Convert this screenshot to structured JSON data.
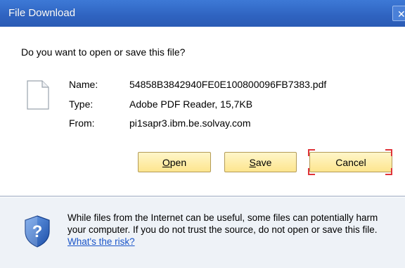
{
  "window": {
    "title": "File Download",
    "close_glyph": "✕"
  },
  "prompt": "Do you want to open or save this file?",
  "file": {
    "icon": "document-icon",
    "name_label": "Name:",
    "name_value": "54858B3842940FE0E100800096FB7383.pdf",
    "type_label": "Type:",
    "type_value": "Adobe PDF Reader, 15,7KB",
    "from_label": "From:",
    "from_value": "pi1sapr3.ibm.be.solvay.com"
  },
  "buttons": {
    "open_accel": "O",
    "open_rest": "pen",
    "save_accel": "S",
    "save_rest": "ave",
    "cancel": "Cancel",
    "focused": "Cancel"
  },
  "footer": {
    "icon": "security-shield-question-icon",
    "warning": "While files from the Internet can be useful, some files can potentially harm your computer. If you do not trust the source, do not open or save this file.",
    "link": "What's the risk?"
  },
  "colors": {
    "title_bar": "#2f63c0",
    "button_fill": "#fde58e",
    "focus_corners": "#e0343a",
    "footer_bg": "#eef2f7",
    "link": "#1a55c9"
  }
}
